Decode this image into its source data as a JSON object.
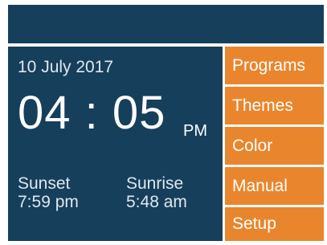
{
  "status": {
    "date": "10 July 2017"
  },
  "clock": {
    "time": "04 : 05",
    "period": "PM"
  },
  "sun": {
    "sunset_label": "Sunset",
    "sunset_time": "7:59 pm",
    "sunrise_label": "Sunrise",
    "sunrise_time": "5:48 am"
  },
  "menu": {
    "items": [
      {
        "label": "Programs"
      },
      {
        "label": "Themes"
      },
      {
        "label": "Color"
      },
      {
        "label": "Manual"
      },
      {
        "label": "Setup"
      }
    ]
  },
  "colors": {
    "panel": "#163f5c",
    "accent": "#e9862d",
    "background": "#ffffff"
  }
}
